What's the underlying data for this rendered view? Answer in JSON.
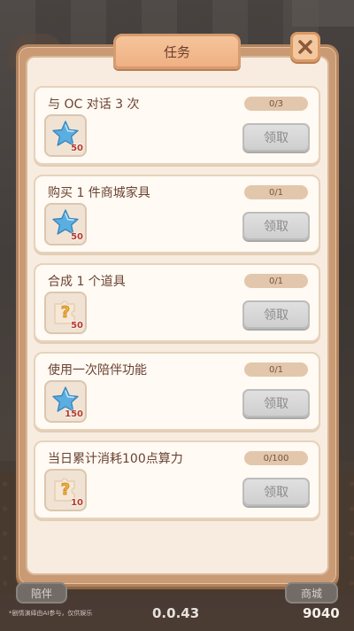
{
  "dialog": {
    "title": "任务"
  },
  "tasks": [
    {
      "title": "与 OC 对话 3 次",
      "progress": "0/3",
      "reward_icon": "star-icon",
      "reward_qty": "50",
      "button": "领取"
    },
    {
      "title": "购买 1 件商城家具",
      "progress": "0/1",
      "reward_icon": "star-icon",
      "reward_qty": "50",
      "button": "领取"
    },
    {
      "title": "合成 1 个道具",
      "progress": "0/1",
      "reward_icon": "mystery-puzzle-icon",
      "reward_qty": "50",
      "button": "领取"
    },
    {
      "title": "使用一次陪伴功能",
      "progress": "0/1",
      "reward_icon": "star-icon",
      "reward_qty": "150",
      "button": "领取"
    },
    {
      "title": "当日累计消耗100点算力",
      "progress": "0/100",
      "reward_icon": "mystery-puzzle-icon",
      "reward_qty": "10",
      "button": "领取"
    }
  ],
  "bottom": {
    "left_button": "陪伴",
    "right_button": "商城",
    "disclaimer": "*剧情演绎由AI参与，仅供娱乐",
    "version": "0.0.43",
    "coins": "9040"
  },
  "colors": {
    "star": "#5aaee0",
    "accent": "#efb184",
    "claim_disabled": "#cfcfcf"
  }
}
